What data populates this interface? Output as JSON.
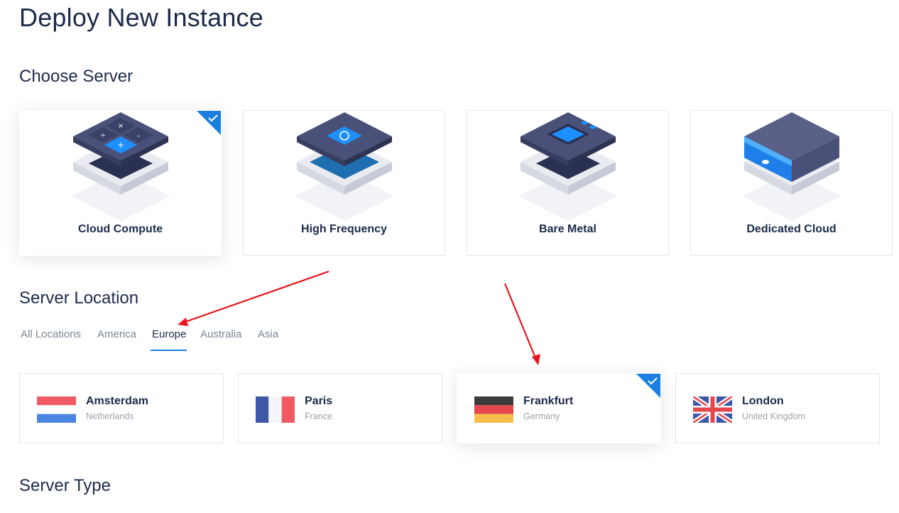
{
  "page": {
    "title": "Deploy New Instance"
  },
  "sections": {
    "choose_server": "Choose Server",
    "server_location": "Server Location",
    "server_type": "Server Type"
  },
  "servers": [
    {
      "name": "Cloud Compute",
      "icon": "cloud-compute-illustration",
      "selected": true
    },
    {
      "name": "High Frequency",
      "icon": "high-frequency-illustration",
      "selected": false
    },
    {
      "name": "Bare Metal",
      "icon": "bare-metal-illustration",
      "selected": false
    },
    {
      "name": "Dedicated Cloud",
      "icon": "dedicated-cloud-illustration",
      "selected": false
    }
  ],
  "location_tabs": [
    {
      "label": "All Locations",
      "active": false
    },
    {
      "label": "America",
      "active": false
    },
    {
      "label": "Europe",
      "active": true
    },
    {
      "label": "Australia",
      "active": false
    },
    {
      "label": "Asia",
      "active": false
    }
  ],
  "locations": [
    {
      "city": "Amsterdam",
      "country": "Netherlands",
      "flag": "netherlands-flag",
      "selected": false
    },
    {
      "city": "Paris",
      "country": "France",
      "flag": "france-flag",
      "selected": false
    },
    {
      "city": "Frankfurt",
      "country": "Germany",
      "flag": "germany-flag",
      "selected": true
    },
    {
      "city": "London",
      "country": "United Kingdom",
      "flag": "uk-flag",
      "selected": false
    }
  ],
  "colors": {
    "accent": "#1a7fdf",
    "title": "#1c2b4a",
    "muted": "#7a8594",
    "annotation_arrow": "#e8141b"
  }
}
